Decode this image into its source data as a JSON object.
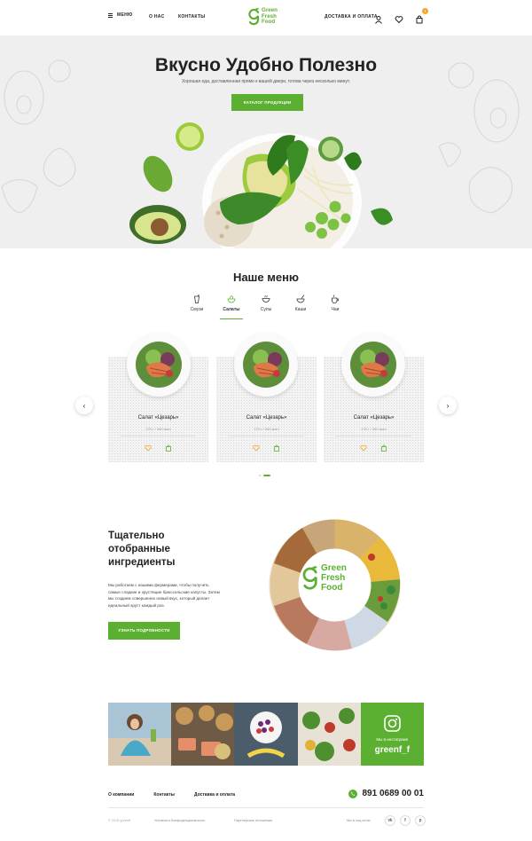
{
  "header": {
    "menu_label": "МЕНЮ",
    "about_label": "О НАС",
    "contacts_label": "КОНТАКТЫ",
    "logo_lines": [
      "Green",
      "Fresh",
      "Food"
    ],
    "delivery_label": "ДОСТАВКА И ОПЛАТА",
    "cart_count": "1",
    "icons": [
      "user-icon",
      "heart-icon",
      "cart-icon"
    ]
  },
  "hero": {
    "title": "Вкусно Удобно Полезно",
    "subtitle": "Хорошая еда, доставленная прямо к вашей двери, готова через несколько минут.",
    "button": "КАТАЛОГ ПРОДУКЦИИ"
  },
  "menu": {
    "title": "Наше меню",
    "categories": [
      {
        "label": "Смузи",
        "icon": "smoothie-icon",
        "active": false
      },
      {
        "label": "Салаты",
        "icon": "salad-icon",
        "active": true
      },
      {
        "label": "Супы",
        "icon": "soup-icon",
        "active": false
      },
      {
        "label": "Каши",
        "icon": "porridge-icon",
        "active": false
      },
      {
        "label": "Чаи",
        "icon": "tea-icon",
        "active": false
      }
    ],
    "products": [
      {
        "name": "Салат «Цезарь»",
        "meta": "170 г / 340 ккал"
      },
      {
        "name": "Салат «Цезарь»",
        "meta": "170 г / 340 ккал"
      },
      {
        "name": "Салат «Цезарь»",
        "meta": "170 г / 340 ккал"
      }
    ],
    "prev_arrow": "‹",
    "next_arrow": "›"
  },
  "ingredients": {
    "title": "Тщательно отобранные ингредиенты",
    "text": "Мы работаем с нашими фермерами, чтобы получить самые сладкие и хрустящие брюссельские капусты. Затем мы создаем совершенно новый вкус, который делает идеальный хруст каждый раз.",
    "button": "УЗНАТЬ ПОДРОБНОСТИ",
    "logo_lines": [
      "Green",
      "Fresh",
      "Food"
    ]
  },
  "instagram": {
    "label": "Мы в инстаграме",
    "handle": "greenf_f"
  },
  "footer": {
    "links": [
      "О компании",
      "Контакты",
      "Доставка и оплата"
    ],
    "phone": "891 0689 00 01",
    "copyright": "© 2016 greenff",
    "terms": "Условия и Конфиденциальность",
    "partners": "Партнерские отношения",
    "social_label": "Мы в соц.сетях",
    "social": [
      "vk",
      "f",
      "p"
    ]
  },
  "colors": {
    "accent": "#5cb031",
    "badge": "#f5a623"
  }
}
